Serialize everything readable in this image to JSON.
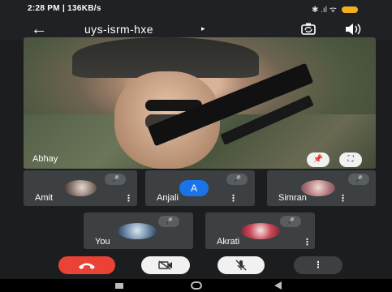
{
  "status_bar": {
    "time": "2:28 PM | 136KB/s",
    "icons_text": "✱ .ıl ᯤ"
  },
  "top_bar": {
    "meeting_code": "uys-isrm-hxe",
    "caret": "▸"
  },
  "main_video": {
    "name": "Abhay"
  },
  "participants": [
    {
      "name": "Amit"
    },
    {
      "name": "Anjali",
      "avatar_letter": "A"
    },
    {
      "name": "Simran"
    },
    {
      "name": "You"
    },
    {
      "name": "Akrati"
    }
  ],
  "glyphs": {
    "more": "⋮",
    "mic_off": "🎙̸"
  },
  "colors": {
    "end_call": "#ea4335",
    "avatar_blue": "#1a73e8",
    "tile_bg": "#3c4043"
  }
}
